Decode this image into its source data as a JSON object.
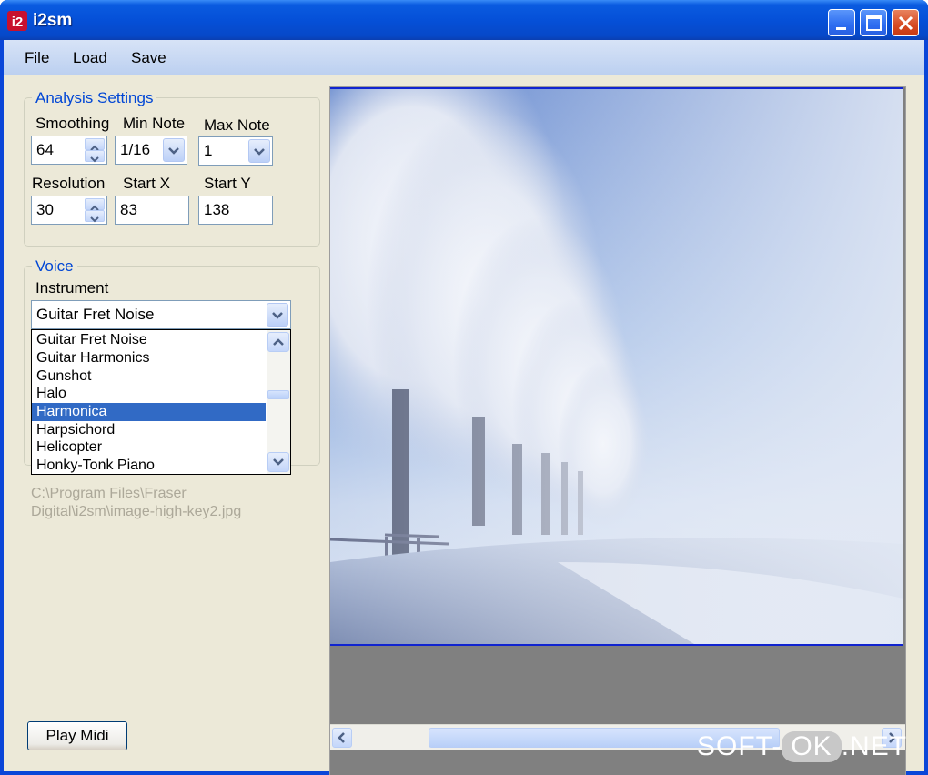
{
  "window": {
    "title": "i2sm",
    "app_icon": "i2-logo-icon",
    "controls": [
      "minimize-icon",
      "maximize-icon",
      "close-icon"
    ]
  },
  "menu": {
    "items": [
      "File",
      "Load",
      "Save"
    ]
  },
  "analysis": {
    "title": "Analysis Settings",
    "smoothing": {
      "label": "Smoothing",
      "value": "64"
    },
    "min_note": {
      "label": "Min Note",
      "value": "1/16"
    },
    "max_note": {
      "label": "Max Note",
      "value": "1"
    },
    "resolution": {
      "label": "Resolution",
      "value": "30"
    },
    "start_x": {
      "label": "Start X",
      "value": "83"
    },
    "start_y": {
      "label": "Start Y",
      "value": "138"
    }
  },
  "voice": {
    "title": "Voice",
    "instrument_label": "Instrument",
    "instrument_value": "Guitar Fret Noise",
    "list": [
      "Guitar Fret Noise",
      "Guitar Harmonics",
      "Gunshot",
      "Halo",
      "Harmonica",
      "Harpsichord",
      "Helicopter",
      "Honky-Tonk Piano"
    ],
    "selected": "Harmonica"
  },
  "file_path": "C:\\Program Files\\Fraser Digital\\i2sm\\image-high-key2.jpg",
  "play_button": "Play Midi",
  "image": {
    "description_icon": "frosted-trees-image"
  },
  "watermark": {
    "left": "SOFT-",
    "mid": "OK",
    "right": ".NET"
  },
  "colors": {
    "title_blue": "#0550d8",
    "selection": "#316ac5",
    "group_title": "#0046d5",
    "face": "#ece9d8"
  }
}
